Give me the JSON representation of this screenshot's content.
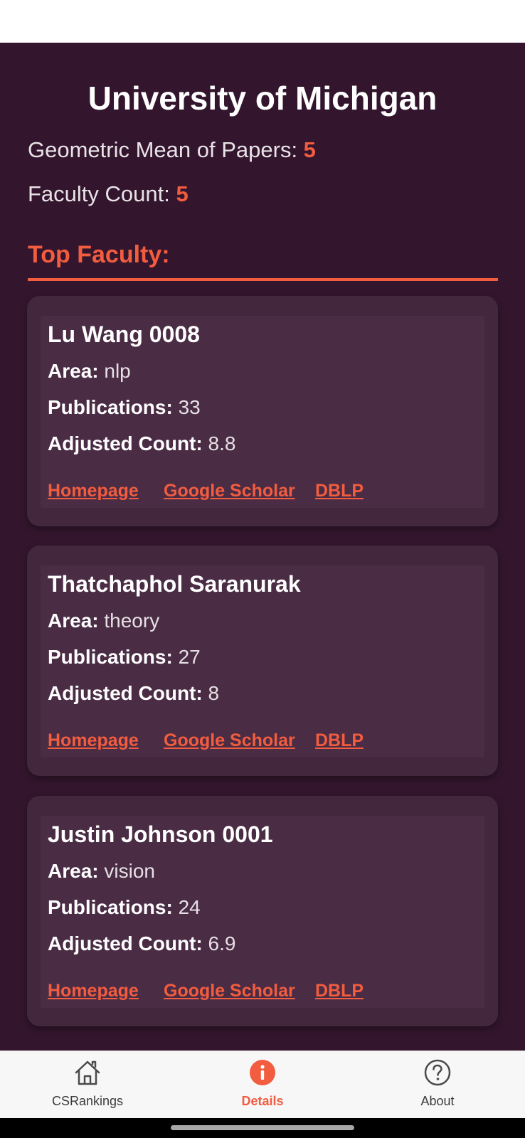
{
  "university": {
    "name": "University of Michigan"
  },
  "stats": {
    "geo_mean_label": "Geometric Mean of Papers: ",
    "geo_mean_value": "5",
    "faculty_count_label": "Faculty Count: ",
    "faculty_count_value": "5"
  },
  "section": {
    "title": "Top Faculty:"
  },
  "faculty": [
    {
      "name": "Lu Wang 0008",
      "area_label": "Area:",
      "area": " nlp",
      "pubs_label": "Publications:",
      "pubs": " 33",
      "adj_label": "Adjusted Count:",
      "adj": " 8.8",
      "links": {
        "homepage": "Homepage",
        "scholar": "Google Scholar",
        "dblp": "DBLP"
      }
    },
    {
      "name": "Thatchaphol Saranurak",
      "area_label": "Area:",
      "area": " theory",
      "pubs_label": "Publications:",
      "pubs": " 27",
      "adj_label": "Adjusted Count:",
      "adj": " 8",
      "links": {
        "homepage": "Homepage",
        "scholar": "Google Scholar",
        "dblp": "DBLP"
      }
    },
    {
      "name": "Justin Johnson 0001",
      "area_label": "Area:",
      "area": " vision",
      "pubs_label": "Publications:",
      "pubs": " 24",
      "adj_label": "Adjusted Count:",
      "adj": " 6.9",
      "links": {
        "homepage": "Homepage",
        "scholar": "Google Scholar",
        "dblp": "DBLP"
      }
    }
  ],
  "tabs": [
    {
      "label": "CSRankings",
      "icon": "home-icon",
      "active": false
    },
    {
      "label": "Details",
      "icon": "info-icon",
      "active": true
    },
    {
      "label": "About",
      "icon": "help-icon",
      "active": false
    }
  ],
  "colors": {
    "accent": "#f25c3f",
    "background": "#33162d",
    "card": "#42273d",
    "card_inner": "#4a2c45"
  }
}
